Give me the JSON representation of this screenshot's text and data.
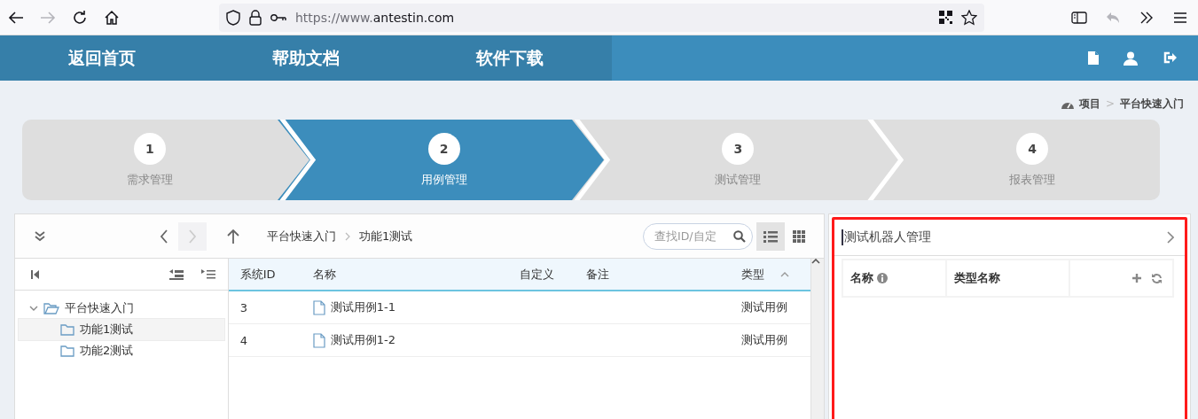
{
  "browser": {
    "url_scheme": "https://www.",
    "url_host": "antestin.com",
    "forward_disabled": true
  },
  "nav": {
    "items": [
      {
        "label": "返回首页"
      },
      {
        "label": "帮助文档"
      },
      {
        "label": "软件下载"
      }
    ]
  },
  "breadcrumb": {
    "items": [
      "项目",
      "平台快速入门"
    ],
    "separator": ">"
  },
  "steps": [
    {
      "number": "1",
      "label": "需求管理",
      "selected": false
    },
    {
      "number": "2",
      "label": "用例管理",
      "selected": true
    },
    {
      "number": "3",
      "label": "测试管理",
      "selected": false
    },
    {
      "number": "4",
      "label": "报表管理",
      "selected": false
    }
  ],
  "toolbar": {
    "path": [
      "平台快速入门",
      "功能1测试"
    ],
    "search": {
      "placeholder": "查找ID/自定"
    },
    "views": [
      {
        "kind": "list",
        "selected": true
      },
      {
        "kind": "grid",
        "selected": false
      }
    ]
  },
  "tree": [
    {
      "label": "平台快速入门",
      "expanded": true,
      "selected": false,
      "children": [
        {
          "label": "功能1测试",
          "selected": true
        },
        {
          "label": "功能2测试",
          "selected": false
        }
      ]
    }
  ],
  "table": {
    "columns": [
      "系统ID",
      "名称",
      "自定义",
      "备注",
      "类型"
    ],
    "rows": [
      {
        "id": "3",
        "name": "测试用例1-1",
        "type": "测试用例"
      },
      {
        "id": "4",
        "name": "测试用例1-2",
        "type": "测试用例"
      }
    ]
  },
  "robot_panel": {
    "title": "测试机器人管理",
    "columns": [
      "名称",
      "类型名称"
    ]
  }
}
